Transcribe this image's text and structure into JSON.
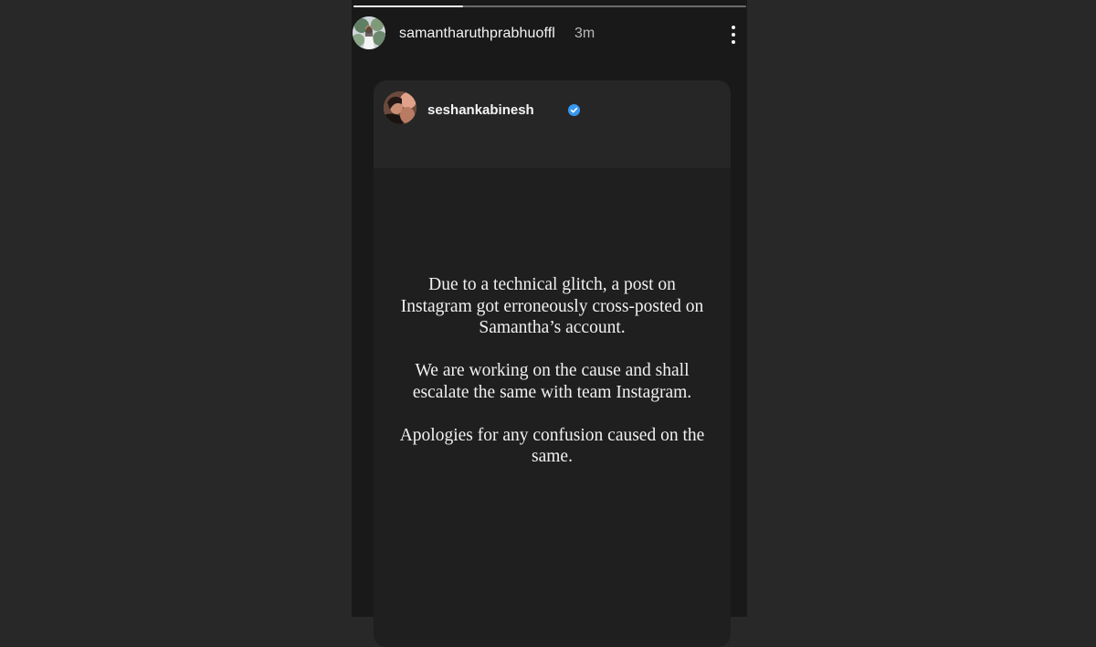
{
  "story": {
    "progress": 0.28,
    "username": "samantharuthprabhuoffl",
    "time": "3m",
    "more_icon": "more-vertical-icon"
  },
  "card": {
    "username": "seshankabinesh",
    "verified_icon": "verified-badge-icon",
    "verified_color": "#3897f0",
    "paragraphs": [
      "Due to a technical glitch, a post on Instagram got erroneously cross-posted on Samantha’s account.",
      "We are working on the cause and shall escalate the same with team Instagram.",
      "Apologies for any confusion caused on the same."
    ]
  },
  "colors": {
    "page_background": "#282828",
    "story_background": "#191919",
    "card_background": "#1f1f1f",
    "text_primary": "#f4f4f4",
    "text_secondary": "#b9b9b9"
  }
}
